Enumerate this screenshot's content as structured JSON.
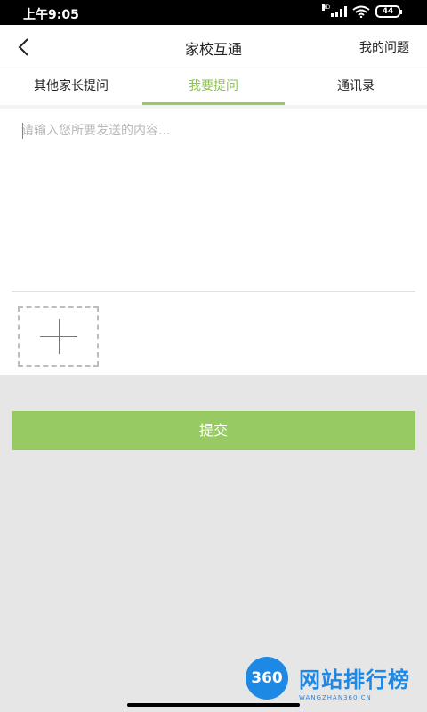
{
  "status_bar": {
    "time": "上午9:05",
    "battery": "44",
    "network": "HD"
  },
  "header": {
    "title": "家校互通",
    "right_link": "我的问题"
  },
  "tabs": [
    {
      "label": "其他家长提问",
      "active": false
    },
    {
      "label": "我要提问",
      "active": true
    },
    {
      "label": "通讯录",
      "active": false
    }
  ],
  "compose": {
    "placeholder": "请输入您所要发送的内容..."
  },
  "submit_label": "提交",
  "watermark": {
    "badge": "360",
    "text": "网站排行榜",
    "sub": "WANGZHAN360.CN"
  },
  "colors": {
    "accent": "#98ca64",
    "background": "#e6e6e6"
  }
}
